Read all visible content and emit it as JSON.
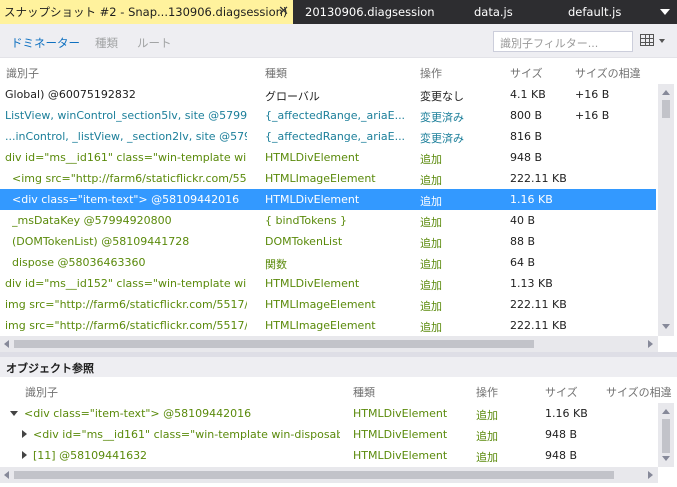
{
  "tabs": [
    {
      "label": "スナップショット #2 - Snap...130906.diagsession)",
      "active": true
    },
    {
      "label": "20130906.diagsession",
      "active": false
    },
    {
      "label": "data.js",
      "active": false
    },
    {
      "label": "default.js",
      "active": false
    }
  ],
  "tab_pin_icon": "pin-icon",
  "tab_close_icon": "close-icon",
  "toolbar": {
    "views": [
      "ドミネーター",
      "種類",
      "ルート"
    ],
    "filter_placeholder": "識別子フィルター..."
  },
  "main_table": {
    "headers": [
      "識別子",
      "種類",
      "操作",
      "サイズ",
      "サイズの相違"
    ],
    "rows": [
      {
        "id": "Global) @60075192832",
        "type": "グローバル",
        "op": "変更なし",
        "size": "4.1 KB",
        "diff": "+16 B",
        "color": "black"
      },
      {
        "id": "ListView, winControl_section5lv, site @5799...",
        "type": "{_affectedRange,_ariaE...",
        "op": "変更済み",
        "size": "800 B",
        "diff": "+16 B",
        "color": "teal"
      },
      {
        "id": "...inControl, _listView, _section2lv, site @5799...",
        "type": "{_affectedRange,_ariaE...",
        "op": "変更済み",
        "size": "816 B",
        "diff": "",
        "color": "teal"
      },
      {
        "id": "div id=\"ms__id161\" class=\"win-template win-d...",
        "type": "HTMLDivElement",
        "op": "追加",
        "size": "948 B",
        "diff": "",
        "color": "green"
      },
      {
        "id": "<img src=\"http://farm6/staticflickr.com/5517...",
        "type": "HTMLImageElement",
        "op": "追加",
        "size": "222.11 KB",
        "diff": "",
        "color": "green",
        "indent": true
      },
      {
        "id": "<div class=\"item-text\"> @58109442016",
        "type": "HTMLDivElement",
        "op": "追加",
        "size": "1.16 KB",
        "diff": "",
        "color": "green",
        "indent": true,
        "selected": true
      },
      {
        "id": "_msDataKey @57994920800",
        "type": "{ bindTokens }",
        "op": "追加",
        "size": "40 B",
        "diff": "",
        "color": "green",
        "indent": true
      },
      {
        "id": "(DOMTokenList) @58109441728",
        "type": "DOMTokenList",
        "op": "追加",
        "size": "88 B",
        "diff": "",
        "color": "green",
        "indent": true
      },
      {
        "id": "dispose @58036463360",
        "type": "関数",
        "op": "追加",
        "size": "64 B",
        "diff": "",
        "color": "green",
        "indent": true
      },
      {
        "id": "div id=\"ms__id152\" class=\"win-template win-d...",
        "type": "HTMLDivElement",
        "op": "追加",
        "size": "1.13 KB",
        "diff": "",
        "color": "green"
      },
      {
        "id": "img src=\"http://farm6/staticflickr.com/5517/96...",
        "type": "HTMLImageElement",
        "op": "追加",
        "size": "222.11 KB",
        "diff": "",
        "color": "green"
      },
      {
        "id": "img src=\"http://farm6/staticflickr.com/5517/96...",
        "type": "HTMLImageElement",
        "op": "追加",
        "size": "222.11 KB",
        "diff": "",
        "color": "green"
      }
    ]
  },
  "ref_panel": {
    "title": "オブジェクト参照",
    "headers": [
      "識別子",
      "種類",
      "操作",
      "サイズ",
      "サイズの相違"
    ],
    "rows": [
      {
        "id": "<div class=\"item-text\"> @58109442016",
        "type": "HTMLDivElement",
        "op": "追加",
        "size": "1.16 KB",
        "expander": "open",
        "level": 0
      },
      {
        "id": "<div id=\"ms__id161\" class=\"win-template win-disposabl...",
        "type": "HTMLDivElement",
        "op": "追加",
        "size": "948 B",
        "expander": "closed",
        "level": 1
      },
      {
        "id": "[11] @58109441632",
        "type": "HTMLDivElement",
        "op": "追加",
        "size": "948 B",
        "expander": "closed",
        "level": 1
      }
    ]
  },
  "colors": {
    "teal": "#1c7f9a",
    "green": "#5a8a0b",
    "selection": "#3399ff",
    "accent": "#0e70c0",
    "tab_active": "#fff29d"
  }
}
